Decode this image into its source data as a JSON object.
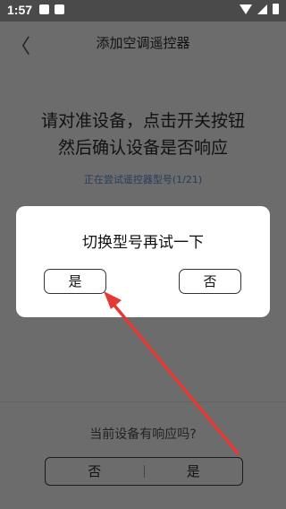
{
  "status_bar": {
    "time": "1:57"
  },
  "header": {
    "back_glyph": "〈",
    "title": "添加空调遥控器"
  },
  "instruction": {
    "line1": "请对准设备，点击开关按钮",
    "line2": "然后确认设备是否响应"
  },
  "trying_text": "正在尝试遥控器型号(1/21)",
  "bottom": {
    "question": "当前设备有响应吗?",
    "no_label": "否",
    "yes_label": "是"
  },
  "dialog": {
    "title": "切换型号再试一下",
    "yes_label": "是",
    "no_label": "否"
  },
  "colors": {
    "overlay_bg": "#6c6c6c",
    "annotation_arrow": "#e53935",
    "dialog_bg": "#ffffff"
  }
}
